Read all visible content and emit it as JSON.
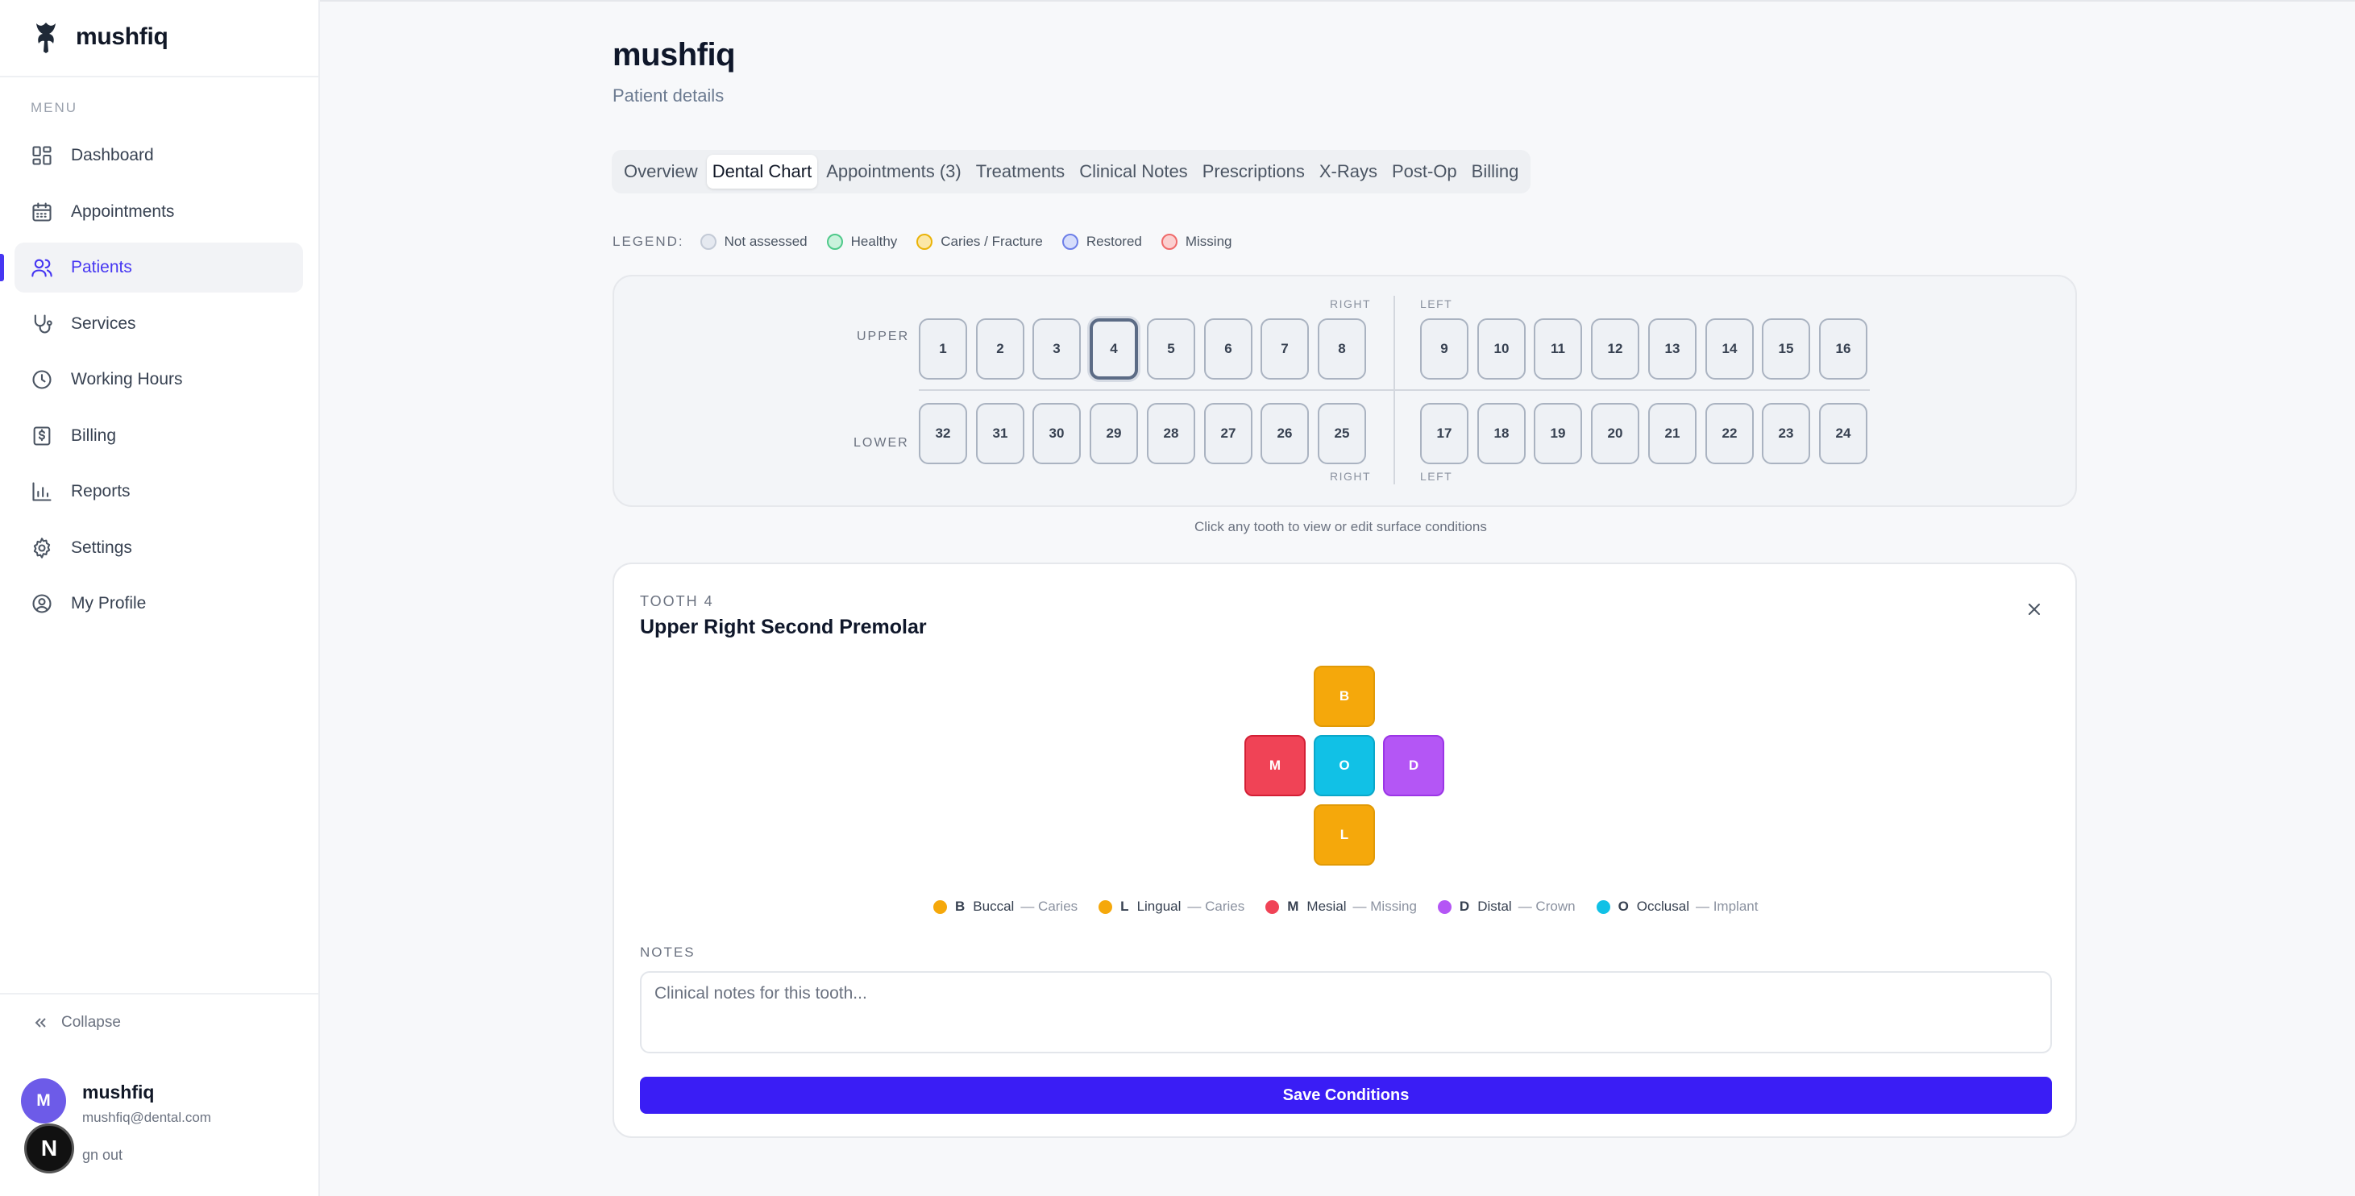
{
  "app": {
    "name": "mushfiq"
  },
  "sidebar": {
    "menu_label": "MENU",
    "items": [
      {
        "label": "Dashboard",
        "icon": "dashboard-icon"
      },
      {
        "label": "Appointments",
        "icon": "calendar-icon"
      },
      {
        "label": "Patients",
        "icon": "users-icon",
        "active": true
      },
      {
        "label": "Services",
        "icon": "stethoscope-icon"
      },
      {
        "label": "Working Hours",
        "icon": "clock-icon"
      },
      {
        "label": "Billing",
        "icon": "dollar-icon"
      },
      {
        "label": "Reports",
        "icon": "bar-chart-icon"
      },
      {
        "label": "Settings",
        "icon": "gear-icon"
      },
      {
        "label": "My Profile",
        "icon": "user-circle-icon"
      }
    ],
    "collapse_label": "Collapse",
    "user": {
      "initial": "M",
      "name": "mushfiq",
      "email": "mushfiq@dental.com"
    },
    "signout_label": "gn out",
    "floating_badge": "N"
  },
  "patient": {
    "name": "mushfiq",
    "subtitle": "Patient details"
  },
  "tabs": [
    {
      "label": "Overview"
    },
    {
      "label": "Dental Chart",
      "active": true
    },
    {
      "label": "Appointments (3)"
    },
    {
      "label": "Treatments"
    },
    {
      "label": "Clinical Notes"
    },
    {
      "label": "Prescriptions"
    },
    {
      "label": "X-Rays"
    },
    {
      "label": "Post-Op"
    },
    {
      "label": "Billing"
    }
  ],
  "legend": {
    "title": "LEGEND:",
    "items": [
      {
        "label": "Not assessed",
        "fill": "#e5e9f0",
        "border": "#c3cad6"
      },
      {
        "label": "Healthy",
        "fill": "#c9f2dc",
        "border": "#4fc98a"
      },
      {
        "label": "Caries / Fracture",
        "fill": "#fbe7a6",
        "border": "#eab308"
      },
      {
        "label": "Restored",
        "fill": "#d6ddfb",
        "border": "#6d7fe8"
      },
      {
        "label": "Missing",
        "fill": "#fbd0d0",
        "border": "#ef6b6b"
      }
    ]
  },
  "chart": {
    "upper_label": "UPPER",
    "lower_label": "LOWER",
    "right_label": "RIGHT",
    "left_label": "LEFT",
    "upper_right": [
      "1",
      "2",
      "3",
      "4",
      "5",
      "6",
      "7",
      "8"
    ],
    "upper_left": [
      "9",
      "10",
      "11",
      "12",
      "13",
      "14",
      "15",
      "16"
    ],
    "lower_right": [
      "32",
      "31",
      "30",
      "29",
      "28",
      "27",
      "26",
      "25"
    ],
    "lower_left": [
      "17",
      "18",
      "19",
      "20",
      "21",
      "22",
      "23",
      "24"
    ],
    "selected_tooth": "4",
    "hint": "Click any tooth to view or edit surface conditions"
  },
  "tooth_detail": {
    "kicker": "TOOTH 4",
    "title": "Upper Right Second Premolar",
    "surfaces": {
      "B": {
        "code": "B",
        "name": "Buccal",
        "condition": "— Caries",
        "color": "#f5a80b",
        "border": "#e19a06"
      },
      "M": {
        "code": "M",
        "name": "Mesial",
        "condition": "— Missing",
        "color": "#f04356",
        "border": "#d31f35"
      },
      "O": {
        "code": "O",
        "name": "Occlusal",
        "condition": "— Implant",
        "color": "#11c1e6",
        "border": "#0aa7c9"
      },
      "D": {
        "code": "D",
        "name": "Distal",
        "condition": "— Crown",
        "color": "#b456f5",
        "border": "#9b35e6"
      },
      "L": {
        "code": "L",
        "name": "Lingual",
        "condition": "— Caries",
        "color": "#f5a80b",
        "border": "#e19a06"
      }
    },
    "surface_legend_order": [
      "B",
      "L",
      "M",
      "D",
      "O"
    ],
    "notes_label": "NOTES",
    "notes_placeholder": "Clinical notes for this tooth...",
    "notes_value": "",
    "save_label": "Save Conditions"
  },
  "colors": {
    "accent": "#4636f2",
    "save_button": "#3a1df5"
  }
}
